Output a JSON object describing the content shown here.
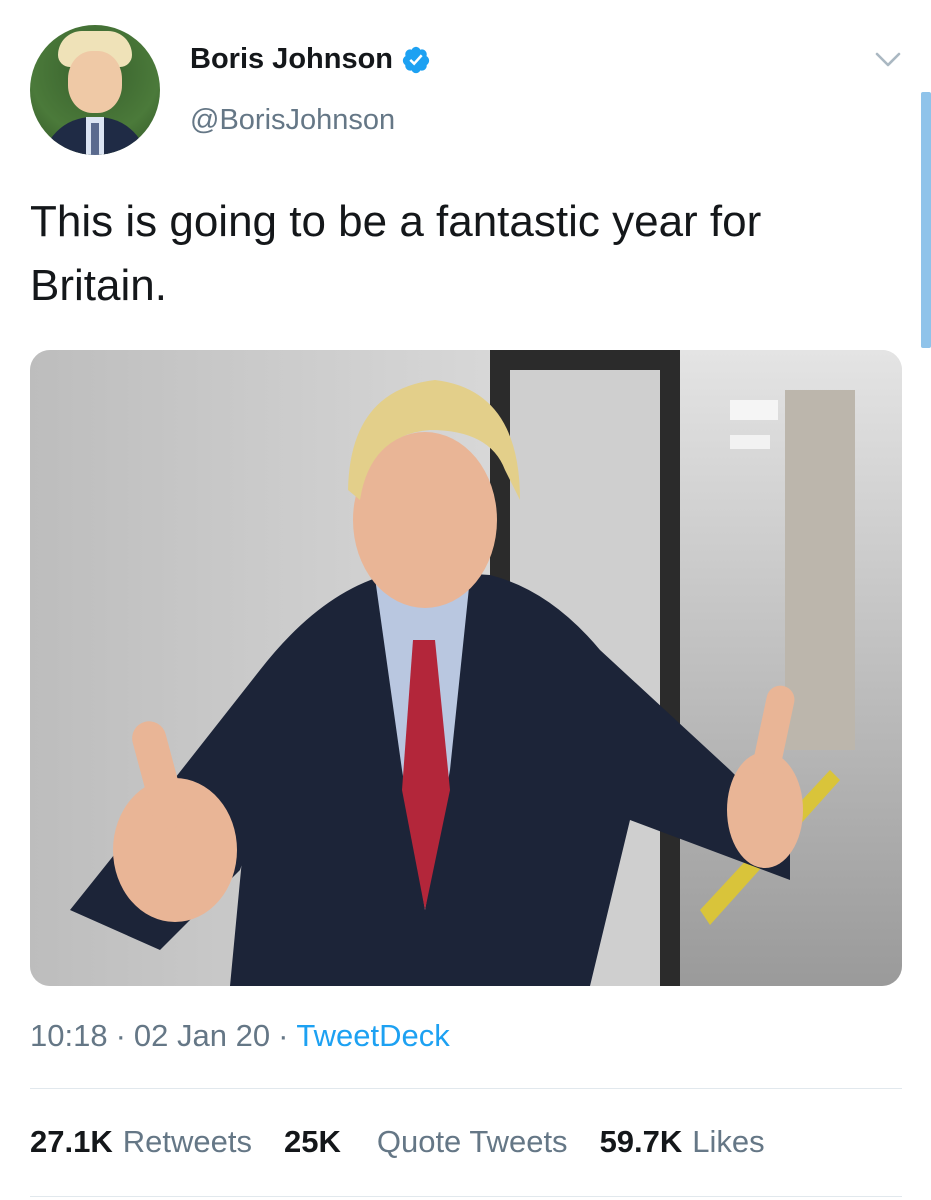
{
  "author": {
    "display_name": "Boris Johnson",
    "handle": "@BorisJohnson",
    "verified": true
  },
  "tweet": {
    "text": "This is going to be a fantastic year for Britain."
  },
  "meta": {
    "time": "10:18",
    "date": "02 Jan 20",
    "separator": "·",
    "source": "TweetDeck"
  },
  "stats": {
    "retweets_count": "27.1K",
    "retweets_label": "Retweets",
    "quotes_count": "25K",
    "quotes_label": "Quote Tweets",
    "likes_count": "59.7K",
    "likes_label": "Likes"
  },
  "icons": {
    "verified": "verified-badge-icon",
    "menu": "chevron-down-icon"
  },
  "colors": {
    "text_primary": "#14171a",
    "text_secondary": "#657786",
    "link": "#1da1f2",
    "verified": "#1da1f2",
    "divider": "#e1e8ed"
  }
}
